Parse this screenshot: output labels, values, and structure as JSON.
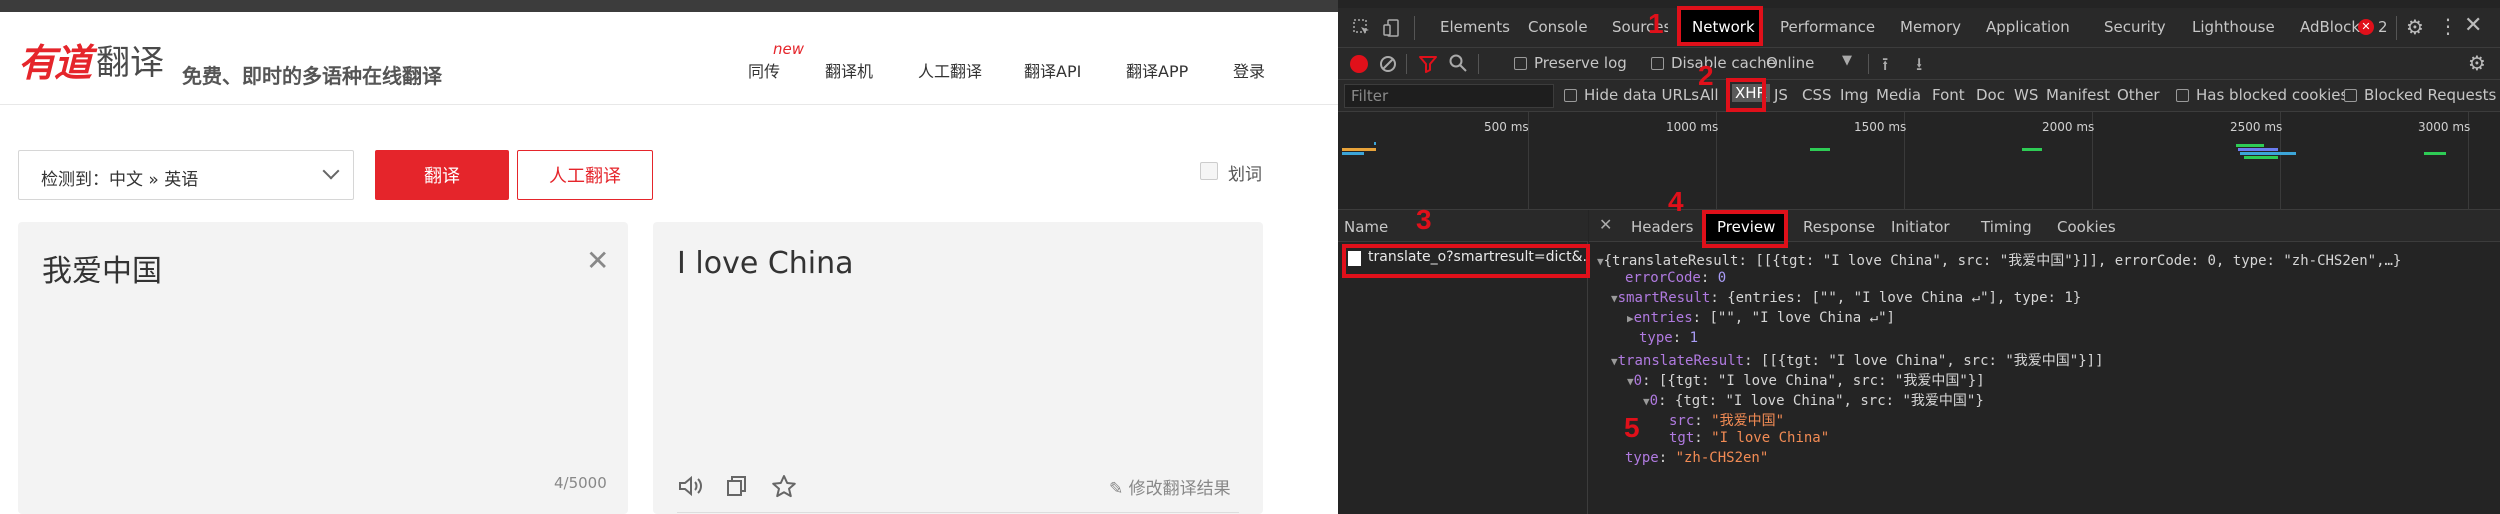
{
  "youdao": {
    "logo": "有道",
    "logo_suffix": "翻译",
    "slogan": "免费、即时的多语种在线翻译",
    "nav": [
      "同传",
      "翻译机",
      "人工翻译",
      "翻译API",
      "翻译APP",
      "登录"
    ],
    "nav_badge": "new",
    "lang_select": "检测到：中文 » 英语",
    "translate_button": "翻译",
    "human_button": "人工翻译",
    "dict_toggle": "划词",
    "source_text": "我爱中国",
    "char_count": "4/5000",
    "target_text": "I love China",
    "edit_label": "修改翻译结果"
  },
  "devtools": {
    "tabs": [
      "Elements",
      "Console",
      "Sources",
      "Network",
      "Performance",
      "Memory",
      "Application",
      "Security",
      "Lighthouse",
      "AdBlock"
    ],
    "active_tab": "Network",
    "error_count": "2",
    "toolbar": {
      "preserve_log": "Preserve log",
      "disable_cache": "Disable cache",
      "throttle": "Online"
    },
    "filter": {
      "placeholder": "Filter",
      "hide_data_urls": "Hide data URLs",
      "types": [
        "All",
        "XHR",
        "JS",
        "CSS",
        "Img",
        "Media",
        "Font",
        "Doc",
        "WS",
        "Manifest",
        "Other"
      ],
      "active_type": "XHR",
      "blocked_cookies": "Has blocked cookies",
      "blocked_requests": "Blocked Requests"
    },
    "timeline_ticks": [
      "500 ms",
      "1000 ms",
      "1500 ms",
      "2000 ms",
      "2500 ms",
      "3000 ms"
    ],
    "name_header": "Name",
    "request_name": "translate_o?smartresult=dict&...",
    "detail_tabs": [
      "Headers",
      "Preview",
      "Response",
      "Initiator",
      "Timing",
      "Cookies"
    ],
    "active_detail_tab": "Preview",
    "preview": {
      "line1": "{translateResult: [[{tgt: \"I love China\", src: \"我爱中国\"}]], errorCode: 0, type: \"zh-CHS2en\",…}",
      "error_key": "errorCode",
      "error_val": "0",
      "smart_key": "smartResult",
      "smart_summary": "{entries: [\"\", \"I love China ↵\"], type: 1}",
      "entries_key": "entries",
      "entries_val": "[\"\", \"I love China ↵\"]",
      "stype_key": "type",
      "stype_val": "1",
      "tr_key": "translateResult",
      "tr_val": "[[{tgt: \"I love China\", src: \"我爱中国\"}]]",
      "tr0_key": "0",
      "tr0_val": "[{tgt: \"I love China\", src: \"我爱中国\"}]",
      "tr00_key": "0",
      "tr00_val": "{tgt: \"I love China\", src: \"我爱中国\"}",
      "src_key": "src",
      "src_val": "\"我爱中国\"",
      "tgt_key": "tgt",
      "tgt_val": "\"I love China\"",
      "type_key": "type",
      "type_val": "\"zh-CHS2en\""
    },
    "annotations": [
      "1",
      "2",
      "3",
      "4",
      "5"
    ],
    "colors": {
      "highlight": "#e0101a",
      "accent": "#e5252b"
    }
  }
}
